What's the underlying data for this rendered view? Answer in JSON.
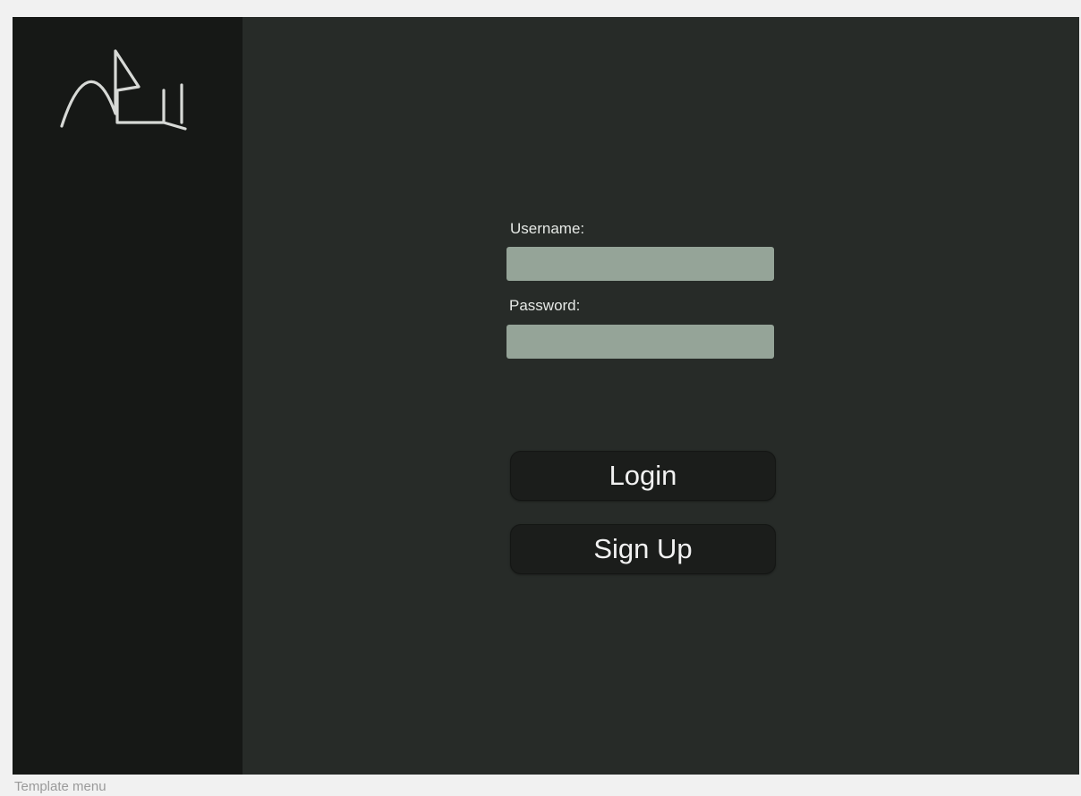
{
  "form": {
    "username_label": "Username:",
    "username_value": "",
    "password_label": "Password:",
    "password_value": ""
  },
  "actions": {
    "login_label": "Login",
    "signup_label": "Sign Up"
  },
  "footer": {
    "caption": "Template menu"
  },
  "icons": {
    "logo": "app-logo"
  },
  "colors": {
    "sidebar_bg": "#161816",
    "main_bg": "#272b28",
    "input_bg": "#95a498",
    "button_bg": "#1b1d1b",
    "text": "#e6e9e6"
  }
}
